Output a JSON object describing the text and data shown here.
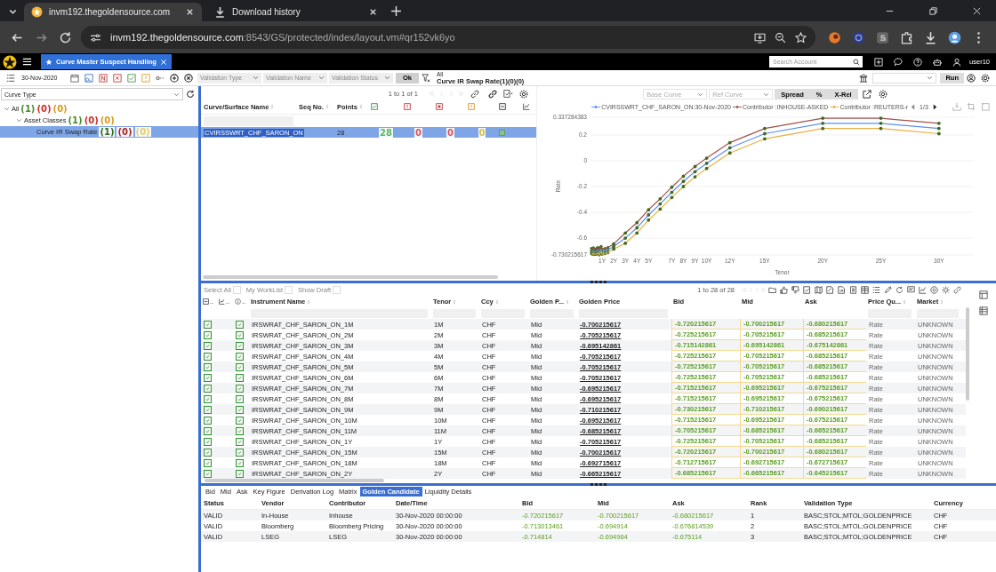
{
  "browser": {
    "tabs": [
      {
        "kind": "site",
        "title": "invm192.thegoldensource.com",
        "selected": true
      },
      {
        "kind": "download",
        "title": "Download history",
        "selected": false
      }
    ],
    "url": {
      "host": "invm192.thegoldensource.com",
      "path": ":8543/GS/protected/index/layout.vm#qr152vk6yo"
    }
  },
  "app": {
    "tab": "Curve Master Suspect Handling",
    "search": {
      "placeholder": "Search Account"
    },
    "user": "user10"
  },
  "toolbar": {
    "date": "30-Nov-2020",
    "filters": [
      {
        "placeholder": "Validation Type"
      },
      {
        "placeholder": "Validation Name"
      },
      {
        "placeholder": "Validation Status"
      }
    ],
    "ok": "Ok",
    "breadcrumb": {
      "root": "All",
      "current": "Curve IR Swap Rate(1)(0)(0)"
    },
    "run": "Run"
  },
  "sidebar": {
    "filter": "Curve Type",
    "tree": [
      {
        "label": "All",
        "counts": [
          {
            "text": "(1)",
            "color": "#4b8b2b"
          },
          {
            "text": "(0)",
            "color": "#c9302c"
          },
          {
            "text": "(0)",
            "color": "#d89a1c"
          }
        ],
        "expanded": true,
        "selected": false,
        "children": [
          {
            "label": "Asset Classes",
            "counts": [
              {
                "text": "(1)",
                "color": "#4b8b2b"
              },
              {
                "text": "(0)",
                "color": "#c9302c"
              },
              {
                "text": "(0)",
                "color": "#d89a1c"
              }
            ],
            "expanded": true,
            "selected": false,
            "children": [
              {
                "label": "Curve IR Swap Rate",
                "counts": [
                  {
                    "text": "(1)",
                    "color": "#2e6b1a"
                  },
                  {
                    "text": "(0)",
                    "color": "#b02020"
                  },
                  {
                    "text": "(0)",
                    "color": "#e8d060"
                  }
                ],
                "selected": true
              }
            ]
          }
        ]
      }
    ]
  },
  "curve_grid": {
    "pager": "1 to 1 of 1",
    "columns": [
      "Curve/Surface Name",
      "Seq No.",
      "Points"
    ],
    "rows": [
      {
        "name": "CVIRSSWRT_CHF_SARON_ON",
        "points": "28",
        "counts": [
          {
            "text": "28",
            "color": "#5cb85c"
          },
          {
            "text": "0",
            "color": "#e05050"
          },
          {
            "text": "0",
            "color": "#e05050"
          },
          {
            "text": "0",
            "color": "#d8c040"
          }
        ],
        "selected": true
      }
    ]
  },
  "chart": {
    "controls": {
      "base": "Base Curve",
      "ref": "Ref Curve",
      "modes": [
        "Spread",
        "%",
        "X-Rel"
      ]
    },
    "legend_page": "1/3",
    "chart_data": {
      "type": "line",
      "xlabel": "Tenor",
      "ylabel": "Rate",
      "x": [
        0.083,
        0.167,
        0.25,
        0.333,
        0.417,
        0.5,
        0.583,
        0.667,
        0.75,
        0.833,
        0.917,
        1,
        1.25,
        1.5,
        2,
        3,
        4,
        5,
        6,
        7,
        8,
        9,
        10,
        12,
        15,
        20,
        25,
        30
      ],
      "series": [
        {
          "name": "CVIRSSWRT_CHF_SARON_ON:30-Nov-2020",
          "color": "#5b8ff0",
          "values": [
            -0.7,
            -0.705,
            -0.695,
            -0.705,
            -0.705,
            -0.705,
            -0.695,
            -0.695,
            -0.71,
            -0.695,
            -0.685,
            -0.705,
            -0.7,
            -0.693,
            -0.665,
            -0.6,
            -0.52,
            -0.42,
            -0.335,
            -0.245,
            -0.16,
            -0.085,
            -0.02,
            0.1,
            0.21,
            0.29,
            0.29,
            0.25
          ]
        },
        {
          "name": "Contributor :INHOUSE-ASKED",
          "color": "#a0524a",
          "values": [
            -0.68,
            -0.685,
            -0.675,
            -0.685,
            -0.685,
            -0.685,
            -0.675,
            -0.675,
            -0.69,
            -0.675,
            -0.665,
            -0.685,
            -0.68,
            -0.673,
            -0.645,
            -0.56,
            -0.48,
            -0.38,
            -0.295,
            -0.205,
            -0.12,
            -0.045,
            0.02,
            0.14,
            0.25,
            0.33,
            0.33,
            0.29
          ]
        },
        {
          "name": "Contributor :REUTERS-r",
          "color": "#e8b040",
          "values": [
            -0.72,
            -0.725,
            -0.715,
            -0.725,
            -0.725,
            -0.725,
            -0.715,
            -0.715,
            -0.73,
            -0.715,
            -0.705,
            -0.725,
            -0.72,
            -0.713,
            -0.685,
            -0.64,
            -0.56,
            -0.46,
            -0.375,
            -0.285,
            -0.2,
            -0.125,
            -0.06,
            0.06,
            0.17,
            0.25,
            0.25,
            0.21
          ]
        }
      ],
      "grid": true,
      "xlim": [
        0,
        33
      ],
      "ylim": [
        -0.730215617,
        0.337284383
      ],
      "xticks": [
        {
          "value": 1,
          "label": "1Y"
        },
        {
          "value": 2,
          "label": "2Y"
        },
        {
          "value": 3,
          "label": "3Y"
        },
        {
          "value": 4,
          "label": "4Y"
        },
        {
          "value": 5,
          "label": "5Y"
        },
        {
          "value": 7,
          "label": "7Y"
        },
        {
          "value": 8,
          "label": "8Y"
        },
        {
          "value": 9,
          "label": "9Y"
        },
        {
          "value": 10,
          "label": "10Y"
        },
        {
          "value": 12,
          "label": "12Y"
        },
        {
          "value": 15,
          "label": "15Y"
        },
        {
          "value": 20,
          "label": "20Y"
        },
        {
          "value": 25,
          "label": "25Y"
        },
        {
          "value": 30,
          "label": "30Y"
        }
      ],
      "yticks": [
        {
          "value": 0.337284383,
          "label": "0.337284383"
        },
        0.2,
        0,
        -0.2,
        -0.4,
        -0.6,
        {
          "value": -0.730215617,
          "label": "-0.730215617"
        }
      ]
    }
  },
  "instrument_grid": {
    "options": [
      {
        "label": "Select All",
        "checked": false
      },
      {
        "label": "My WorkList",
        "checked": false
      },
      {
        "label": "Show Draft",
        "checked": false
      }
    ],
    "pager": "1 to 28 of 28",
    "icon_columns": [
      "..",
      "..",
      ".."
    ],
    "columns": [
      "Instrument Name",
      "Tenor",
      "Ccy",
      "Golden P...",
      "Golden Price",
      "Bid",
      "Mid",
      "Ask",
      "Price Qu...",
      "Market"
    ],
    "rows": [
      {
        "checked": true,
        "validated": true,
        "name": "IRSWRAT_CHF_SARON_ON_1M",
        "tenor": "1M",
        "ccy": "CHF",
        "golden_pricing": "Mid",
        "golden_price": "-0.700215617",
        "bid": "-0.720215617",
        "mid": "-0.700215617",
        "ask": "-0.680215617",
        "quote": "Rate",
        "market": "UNKNOWN"
      },
      {
        "checked": true,
        "validated": true,
        "name": "IRSWRAT_CHF_SARON_ON_2M",
        "tenor": "2M",
        "ccy": "CHF",
        "golden_pricing": "Mid",
        "golden_price": "-0.705215617",
        "bid": "-0.725215617",
        "mid": "-0.705215617",
        "ask": "-0.685215617",
        "quote": "Rate",
        "market": "UNKNOWN"
      },
      {
        "checked": true,
        "validated": true,
        "name": "IRSWRAT_CHF_SARON_ON_3M",
        "tenor": "3M",
        "ccy": "CHF",
        "golden_pricing": "Mid",
        "golden_price": "-0.695142861",
        "bid": "-0.715142861",
        "mid": "-0.695142861",
        "ask": "-0.675142861",
        "quote": "Rate",
        "market": "UNKNOWN"
      },
      {
        "checked": true,
        "validated": true,
        "name": "IRSWRAT_CHF_SARON_ON_4M",
        "tenor": "4M",
        "ccy": "CHF",
        "golden_pricing": "Mid",
        "golden_price": "-0.705215617",
        "bid": "-0.725215617",
        "mid": "-0.705215617",
        "ask": "-0.685215617",
        "quote": "Rate",
        "market": "UNKNOWN"
      },
      {
        "checked": true,
        "validated": true,
        "name": "IRSWRAT_CHF_SARON_ON_5M",
        "tenor": "5M",
        "ccy": "CHF",
        "golden_pricing": "Mid",
        "golden_price": "-0.705215617",
        "bid": "-0.725215617",
        "mid": "-0.705215617",
        "ask": "-0.685215617",
        "quote": "Rate",
        "market": "UNKNOWN"
      },
      {
        "checked": true,
        "validated": true,
        "name": "IRSWRAT_CHF_SARON_ON_6M",
        "tenor": "6M",
        "ccy": "CHF",
        "golden_pricing": "Mid",
        "golden_price": "-0.705215617",
        "bid": "-0.725215617",
        "mid": "-0.705215617",
        "ask": "-0.685215617",
        "quote": "Rate",
        "market": "UNKNOWN"
      },
      {
        "checked": true,
        "validated": true,
        "name": "IRSWRAT_CHF_SARON_ON_7M",
        "tenor": "7M",
        "ccy": "CHF",
        "golden_pricing": "Mid",
        "golden_price": "-0.695215617",
        "bid": "-0.715215617",
        "mid": "-0.695215617",
        "ask": "-0.675215617",
        "quote": "Rate",
        "market": "UNKNOWN"
      },
      {
        "checked": true,
        "validated": true,
        "name": "IRSWRAT_CHF_SARON_ON_8M",
        "tenor": "8M",
        "ccy": "CHF",
        "golden_pricing": "Mid",
        "golden_price": "-0.695215617",
        "bid": "-0.715215617",
        "mid": "-0.695215617",
        "ask": "-0.675215617",
        "quote": "Rate",
        "market": "UNKNOWN"
      },
      {
        "checked": true,
        "validated": true,
        "name": "IRSWRAT_CHF_SARON_ON_9M",
        "tenor": "9M",
        "ccy": "CHF",
        "golden_pricing": "Mid",
        "golden_price": "-0.710215617",
        "bid": "-0.730215617",
        "mid": "-0.710215617",
        "ask": "-0.690215617",
        "quote": "Rate",
        "market": "UNKNOWN"
      },
      {
        "checked": true,
        "validated": true,
        "name": "IRSWRAT_CHF_SARON_ON_10M",
        "tenor": "10M",
        "ccy": "CHF",
        "golden_pricing": "Mid",
        "golden_price": "-0.695215617",
        "bid": "-0.715215617",
        "mid": "-0.695215617",
        "ask": "-0.675215617",
        "quote": "Rate",
        "market": "UNKNOWN"
      },
      {
        "checked": true,
        "validated": true,
        "name": "IRSWRAT_CHF_SARON_ON_11M",
        "tenor": "11M",
        "ccy": "CHF",
        "golden_pricing": "Mid",
        "golden_price": "-0.685215617",
        "bid": "-0.705215617",
        "mid": "-0.685215617",
        "ask": "-0.665215617",
        "quote": "Rate",
        "market": "UNKNOWN"
      },
      {
        "checked": true,
        "validated": true,
        "name": "IRSWRAT_CHF_SARON_ON_1Y",
        "tenor": "1Y",
        "ccy": "CHF",
        "golden_pricing": "Mid",
        "golden_price": "-0.705215617",
        "bid": "-0.725215617",
        "mid": "-0.705215617",
        "ask": "-0.685215617",
        "quote": "Rate",
        "market": "UNKNOWN"
      },
      {
        "checked": true,
        "validated": true,
        "name": "IRSWRAT_CHF_SARON_ON_15M",
        "tenor": "15M",
        "ccy": "CHF",
        "golden_pricing": "Mid",
        "golden_price": "-0.700215617",
        "bid": "-0.720215617",
        "mid": "-0.700215617",
        "ask": "-0.680215617",
        "quote": "Rate",
        "market": "UNKNOWN"
      },
      {
        "checked": true,
        "validated": true,
        "name": "IRSWRAT_CHF_SARON_ON_18M",
        "tenor": "18M",
        "ccy": "CHF",
        "golden_pricing": "Mid",
        "golden_price": "-0.692715617",
        "bid": "-0.712715617",
        "mid": "-0.692715617",
        "ask": "-0.672715617",
        "quote": "Rate",
        "market": "UNKNOWN"
      },
      {
        "checked": true,
        "validated": true,
        "name": "IRSWRAT_CHF_SARON_ON_2Y",
        "tenor": "2Y",
        "ccy": "CHF",
        "golden_pricing": "Mid",
        "golden_price": "-0.665215617",
        "bid": "-0.685215617",
        "mid": "-0.665215617",
        "ask": "-0.645215617",
        "quote": "Rate",
        "market": "UNKNOWN"
      }
    ]
  },
  "detail": {
    "tabs": [
      {
        "label": "Bid",
        "selected": false
      },
      {
        "label": "Mid",
        "selected": false
      },
      {
        "label": "Ask",
        "selected": false
      },
      {
        "label": "Key Figure",
        "selected": false
      },
      {
        "label": "Derivation Log",
        "selected": false
      },
      {
        "label": "Matrix",
        "selected": false
      },
      {
        "label": "Golden Candidate",
        "selected": true
      },
      {
        "label": "Liquidity Details",
        "selected": false
      }
    ],
    "columns": [
      "Status",
      "Vendor",
      "Contributor",
      "Date/Time",
      "Bid",
      "Mid",
      "Ask",
      "Rank",
      "Validation Type",
      "Currency"
    ],
    "rows": [
      {
        "status": "VALID",
        "vendor": "In-House",
        "contributor": "Inhouse",
        "datetime": "30-Nov-2020 00:00:00",
        "bid": "-0.720215617",
        "mid": "-0.700215617",
        "ask": "-0.680215617",
        "rank": "1",
        "validation_type": "BASC;STOL;MTOL;GOLDENPRICE",
        "currency": "CHF"
      },
      {
        "status": "VALID",
        "vendor": "Bloomberg",
        "contributor": "Bloomberg Pricing",
        "datetime": "30-Nov-2020 00:00:00",
        "bid": "-0.713013461",
        "mid": "-0.694914",
        "ask": "-0.676814539",
        "rank": "2",
        "validation_type": "BASC;STOL;MTOL;GOLDENPRICE",
        "currency": "CHF"
      },
      {
        "status": "VALID",
        "vendor": "LSEG",
        "contributor": "LSEG",
        "datetime": "30-Nov-2020 00:00:00",
        "bid": "-0.714814",
        "mid": "-0.694964",
        "ask": "-0.675114",
        "rank": "3",
        "validation_type": "BASC;STOL;MTOL;GOLDENPRICE",
        "currency": "CHF"
      }
    ]
  }
}
